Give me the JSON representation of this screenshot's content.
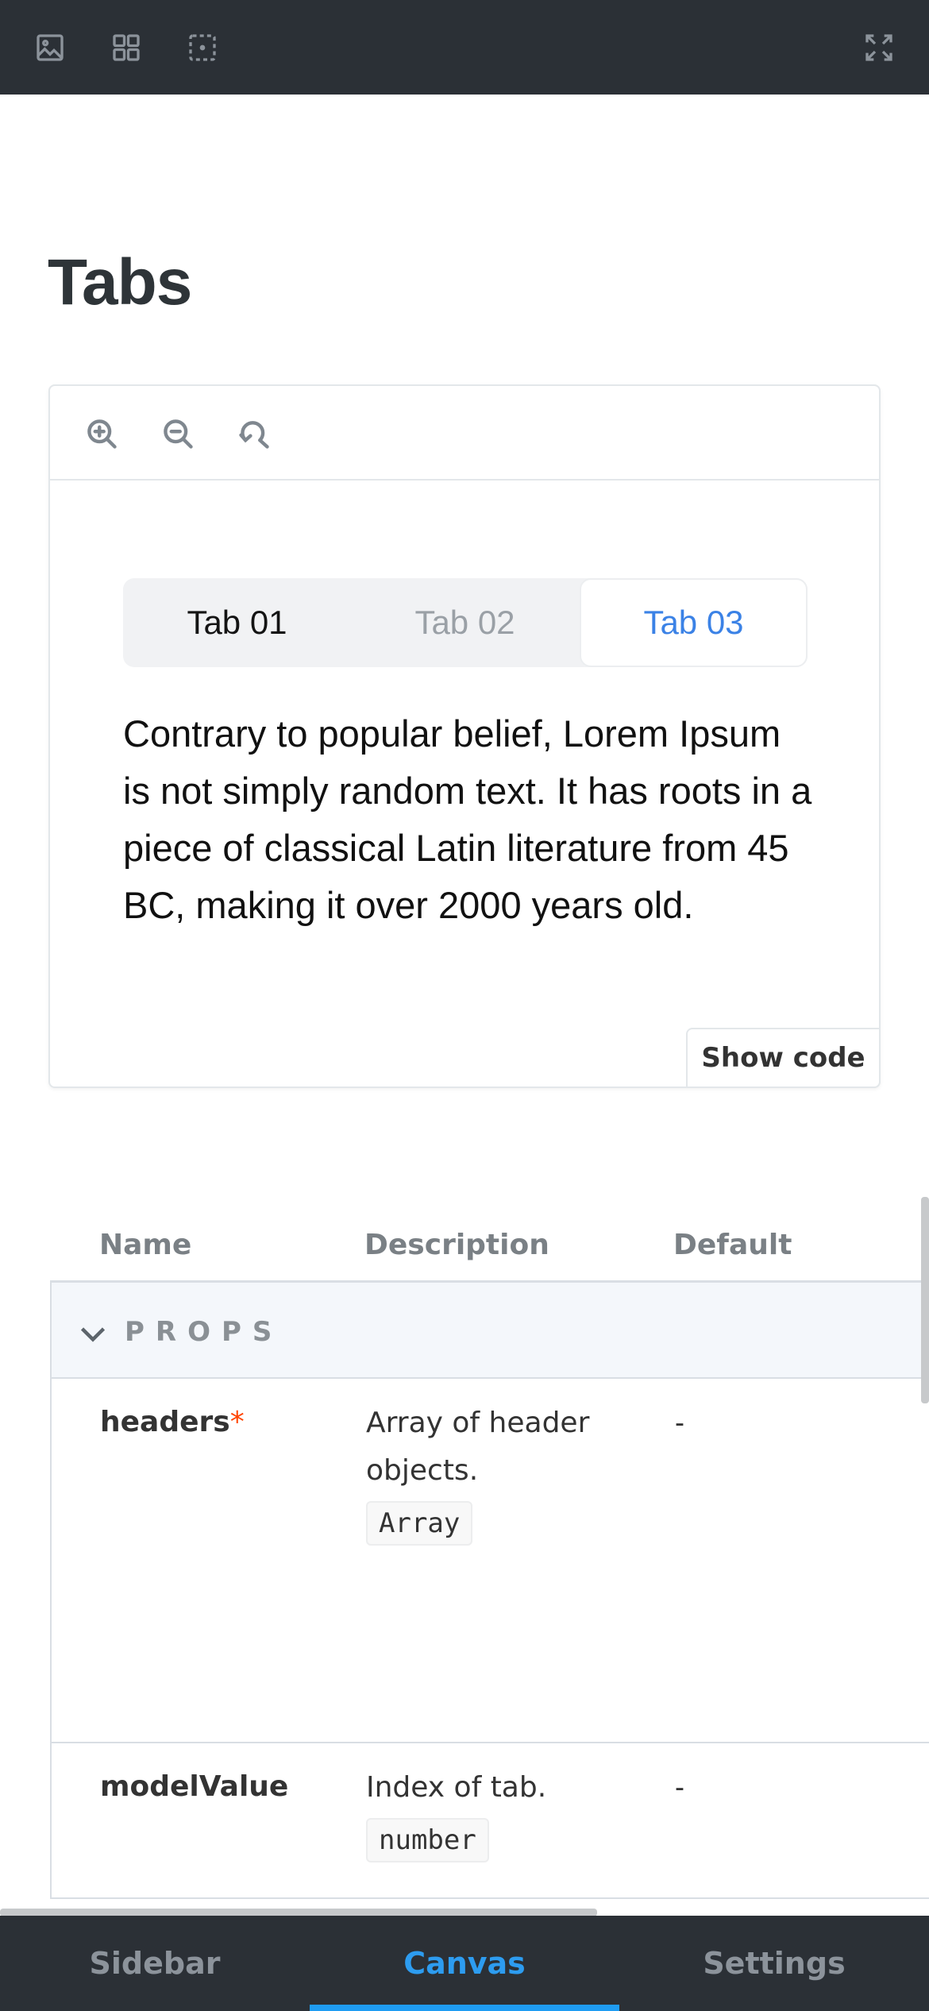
{
  "toolbar": {
    "icons": [
      "image-icon",
      "grid-icon",
      "outline-icon",
      "fullscreen-icon"
    ]
  },
  "page": {
    "title": "Tabs"
  },
  "preview": {
    "zoom_icons": [
      "zoom-in-icon",
      "zoom-out-icon",
      "reset-zoom-icon"
    ],
    "tabs": [
      {
        "label": "Tab 01"
      },
      {
        "label": "Tab 02"
      },
      {
        "label": "Tab 03"
      }
    ],
    "selected_tab": "Tab 03",
    "content": "Contrary to popular belief, Lorem Ipsum is not simply random text. It has roots in a piece of classical Latin literature from 45 BC, making it over 2000 years old.",
    "show_code_label": "Show code"
  },
  "argstable": {
    "headers": {
      "name": "Name",
      "description": "Description",
      "default": "Default"
    },
    "section_label": "PROPS",
    "rows": [
      {
        "name": "headers",
        "required_mark": "*",
        "description": "Array of header objects.",
        "type": "Array",
        "default": "-"
      },
      {
        "name": "modelValue",
        "required_mark": "",
        "description": "Index of tab.",
        "type": "number",
        "default": "-"
      }
    ]
  },
  "bottom_nav": {
    "tabs": [
      {
        "label": "Sidebar"
      },
      {
        "label": "Canvas"
      },
      {
        "label": "Settings"
      }
    ],
    "active": "Canvas"
  },
  "colors": {
    "accent": "#1f9cf2",
    "tab_active": "#3b82e6",
    "required": "#ff4400",
    "bar_bg": "#2b3036"
  }
}
